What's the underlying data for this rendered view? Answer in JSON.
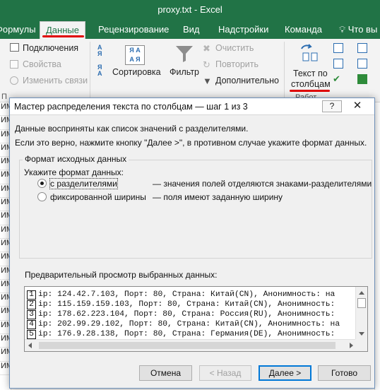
{
  "window": {
    "title": "proxy.txt - Excel"
  },
  "tabs": [
    {
      "label": "Формулы"
    },
    {
      "label": "Данные"
    },
    {
      "label": "Рецензирование"
    },
    {
      "label": "Вид"
    },
    {
      "label": "Надстройки"
    },
    {
      "label": "Команда"
    },
    {
      "label": "Что вы"
    }
  ],
  "ribbon": {
    "connections": "Подключения",
    "properties": "Свойства",
    "edit_links": "Изменить связи",
    "sort": "Сортировка",
    "filter": "Фильтр",
    "clear": "Очистить",
    "reapply": "Повторить",
    "advanced": "Дополнительно",
    "text_to_columns_line1": "Текст по",
    "text_to_columns_line2": "столбцам",
    "group_label_left": "П",
    "group_label_right": "Работ"
  },
  "sheet": {
    "left_cells": [
      "ИМ",
      "ИМ",
      "ИМ",
      "ИМ",
      "ИМ",
      "ИМ",
      "ИМ",
      "ИМ",
      "ИМ",
      "ИМ",
      "ИМ",
      "ИМ",
      "ИМ",
      "ИМ",
      "ИМ",
      "ИМ",
      "ИМ",
      "ИМ",
      "ИМ",
      "ИМ"
    ]
  },
  "dialog": {
    "title": "Мастер распределения текста по столбцам — шаг 1 из 3",
    "help_label": "?",
    "close_label": "✕",
    "intro_line1": "Данные восприняты как список значений с разделителями.",
    "intro_line2": "Если это верно, нажмите кнопку \"Далее >\", в противном случае укажите формат данных.",
    "group_title": "Формат исходных данных",
    "format_prompt": "Укажите формат данных:",
    "options": [
      {
        "label": "с разделителями",
        "desc": "— значения полей отделяются знаками-разделителями",
        "selected": true
      },
      {
        "label": "фиксированной ширины",
        "desc": "— поля имеют заданную ширину",
        "selected": false
      }
    ],
    "preview_label": "Предварительный просмотр выбранных данных:",
    "preview_rows": [
      {
        "n": "1",
        "text": "ip: 124.42.7.103, Порт: 80, Страна: Китай(CN), Анонимность: на"
      },
      {
        "n": "2",
        "text": "ip: 115.159.159.103, Порт: 80, Страна: Китай(CN), Анонимность:"
      },
      {
        "n": "3",
        "text": "ip: 178.62.223.104, Порт: 80, Страна: Россия(RU), Анонимность:"
      },
      {
        "n": "4",
        "text": "ip: 202.99.29.102, Порт: 80, Страна: Китай(CN), Анонимность: на"
      },
      {
        "n": "5",
        "text": "ip: 176.9.28.138, Порт: 80, Страна: Германия(DE), Анонимность:"
      }
    ],
    "buttons": {
      "cancel": "Отмена",
      "back": "< Назад",
      "next": "Далее >",
      "finish": "Готово"
    }
  },
  "colors": {
    "excel_green": "#217346",
    "highlight_red": "#e00000",
    "default_button_border": "#0078d7"
  }
}
